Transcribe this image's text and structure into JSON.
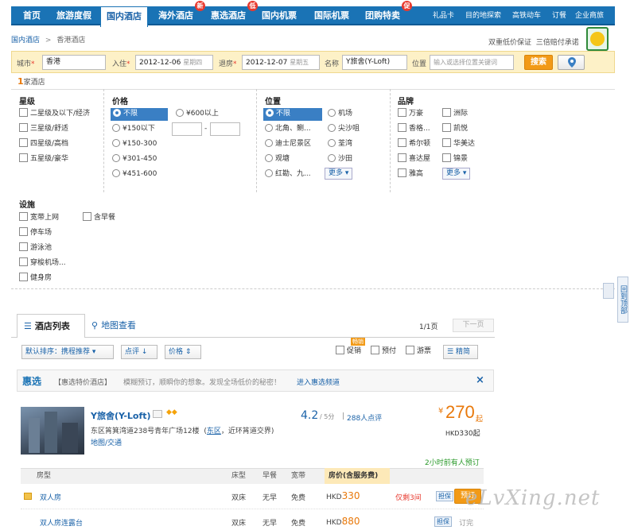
{
  "nav": {
    "items": [
      {
        "label": "首页",
        "active": false,
        "badge": ""
      },
      {
        "label": "旅游度假",
        "active": false,
        "badge": ""
      },
      {
        "label": "国内酒店",
        "active": true,
        "badge": ""
      },
      {
        "label": "海外酒店",
        "active": false,
        "badge": "新"
      },
      {
        "label": "惠选酒店",
        "active": false,
        "badge": "低"
      },
      {
        "label": "国内机票",
        "active": false,
        "badge": ""
      },
      {
        "label": "国际机票",
        "active": false,
        "badge": ""
      },
      {
        "label": "团购特卖",
        "active": false,
        "badge": "促"
      }
    ],
    "right_links": [
      "礼品卡",
      "目的地探索",
      "高铁动车",
      "订餐",
      "企业商旅"
    ]
  },
  "breadcrumb": {
    "root": "国内酒店",
    "separator": ">",
    "current": "香港酒店"
  },
  "guarantee": {
    "text1": "双重低价保证",
    "text2": "三倍赔付承诺"
  },
  "search": {
    "city_label": "城市",
    "city_value": "香港",
    "checkin_label": "入住",
    "checkin_value": "2012-12-06",
    "checkin_weekday": "星期四",
    "checkout_label": "退房",
    "checkout_value": "2012-12-07",
    "checkout_weekday": "星期五",
    "name_label": "名称",
    "name_value": "Y旅舍(Y-Loft)",
    "location_label": "位置",
    "location_placeholder": "输入或选择位置关键词",
    "search_button": "搜索",
    "required_mark": "*"
  },
  "result_count": {
    "number": "1",
    "suffix": "家酒店"
  },
  "filters": {
    "star": {
      "title": "星级",
      "options": [
        "二星级及以下/经济",
        "三星级/舒适",
        "四星级/高档",
        "五星级/豪华"
      ]
    },
    "price": {
      "title": "价格",
      "options": [
        "不限",
        "¥150以下",
        "¥150-300",
        "¥301-450",
        "¥451-600",
        "¥600以上"
      ],
      "range_dash": "-"
    },
    "location": {
      "title": "位置",
      "left": [
        "不限",
        "北角、鲗...",
        "迪士尼景区",
        "观塘",
        "红勘、九..."
      ],
      "right": [
        "机场",
        "尖沙咀",
        "荃湾",
        "沙田"
      ],
      "more": "更多"
    },
    "brand": {
      "title": "品牌",
      "left": [
        "万豪",
        "香格...",
        "希尔顿",
        "喜达屋",
        "雅高"
      ],
      "right": [
        "洲际",
        "凯悦",
        "华美达",
        "锦景"
      ],
      "more": "更多"
    },
    "facility": {
      "title": "设施",
      "left": [
        "宽带上网",
        "停车场",
        "游泳池",
        "穿梭机场...",
        "健身房"
      ],
      "right": [
        "含早餐"
      ]
    }
  },
  "side_widget": {
    "label": "回到顶部"
  },
  "tabs": {
    "list": "酒店列表",
    "map": "地图查看"
  },
  "pager": {
    "page": "1/1页",
    "next": "下一页"
  },
  "sort": {
    "default": "默认排序：携程推荐",
    "rating": "点评",
    "price": "价格",
    "promo": "促销",
    "prepay": "预付",
    "tour": "游票",
    "brief": "精简",
    "new_badge": "畅销"
  },
  "promo_bar": {
    "logo": "惠选",
    "tag": "【惠选特价酒店】",
    "text": "模糊预订，顺瞬你的想象。发现全场低价的秘密！",
    "link": "进入惠选频道",
    "close": "×"
  },
  "hotel": {
    "name": "Y旅舍(Y-Loft)",
    "address": "东区筲箕湾道238号青年广场12楼",
    "district": "东区",
    "nearby": "近环筲道交界",
    "map_link": "地图/交通",
    "score": "4.2",
    "score_max": "/ 5分",
    "reviews": "288人点评",
    "currency_symbol": "¥",
    "price": "270",
    "price_suffix": "起",
    "hkd_label": "HKD",
    "hkd_price": "330",
    "hkd_suffix": "起",
    "recent": "2小时前有人预订"
  },
  "room_table": {
    "headers": [
      "房型",
      "床型",
      "早餐",
      "宽带",
      "房价(含服务费)"
    ],
    "rows": [
      {
        "name": "双人房",
        "bed": "双床",
        "breakfast": "无早",
        "broadband": "免费",
        "currency": "HKD",
        "price": "330",
        "stock": "仅剩3间",
        "tag": "担保",
        "action": "预订"
      },
      {
        "name": "双人房连露台",
        "bed": "双床",
        "breakfast": "无早",
        "broadband": "免费",
        "currency": "HKD",
        "price": "880",
        "stock": "",
        "tag": "担保",
        "action": "订完"
      }
    ]
  },
  "watermark": "eLvXing.net"
}
